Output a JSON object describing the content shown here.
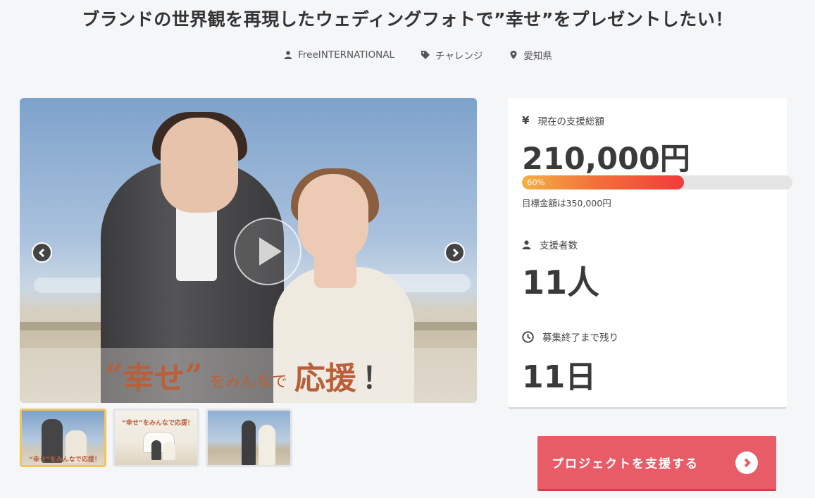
{
  "project": {
    "title": "ブランドの世界観を再現したウェディングフォトで”幸せ”をプレゼントしたい！",
    "owner": "FreeINTERNATIONAL",
    "category": "チャレンジ",
    "location": "愛知県"
  },
  "slider": {
    "caption_quote_open": "“",
    "caption_big1": "幸せ",
    "caption_quote_close": "”",
    "caption_small": "をみんなで",
    "caption_big2": "応援",
    "caption_bang": "！",
    "thumb2_text": "“幸せ”をみんなで応援！",
    "thumb1_text": "“幸せ”をみんなで応援！"
  },
  "stats": {
    "funding_label": "現在の支援総額",
    "funding_amount": "210,000円",
    "progress_percent": 60,
    "progress_label": "60%",
    "goal_text": "目標金額は350,000円",
    "supporters_label": "支援者数",
    "supporters_value": "11人",
    "remaining_label": "募集終了まで残り",
    "remaining_value": "11日",
    "yen_symbol": "¥"
  },
  "cta": {
    "label": "プロジェクトを支援する"
  },
  "colors": {
    "accent": "#e85c68",
    "progress_start": "#f5b041",
    "progress_end": "#f23b3b",
    "active_thumb_border": "#f5c451"
  },
  "icons": {
    "owner": "user-icon",
    "category": "tag-icon",
    "location": "map-pin-icon",
    "funding": "yen-icon",
    "supporters": "user-icon",
    "remaining": "clock-icon"
  }
}
